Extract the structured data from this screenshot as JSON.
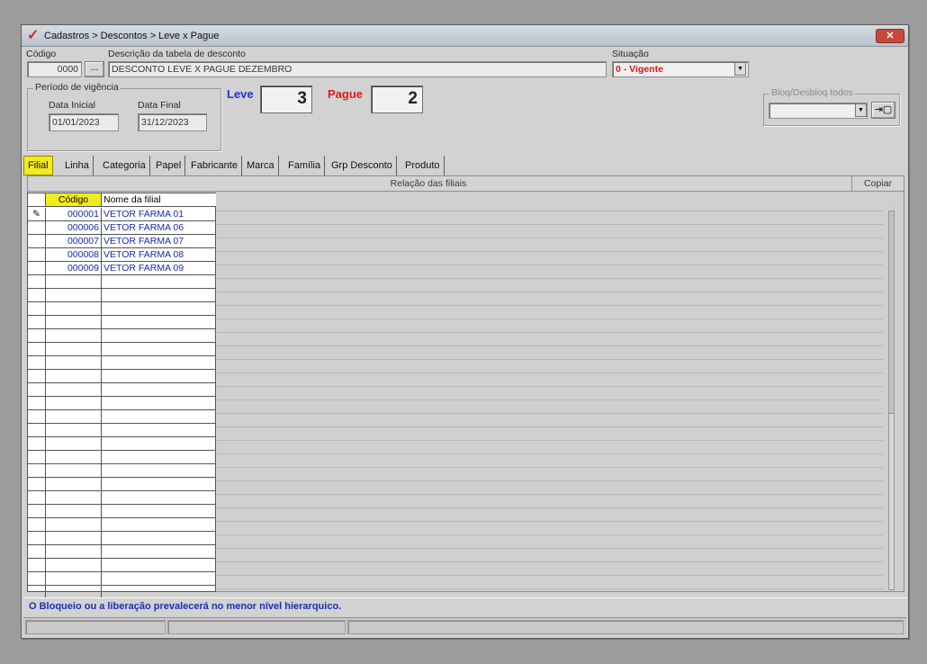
{
  "window": {
    "title": "Cadastros > Descontos > Leve x Pague"
  },
  "header": {
    "codigo_label": "Código",
    "codigo_value": "0000",
    "codigo_lookup": "...",
    "descricao_label": "Descrição da tabela de desconto",
    "descricao_value": "DESCONTO LEVE X PAGUE DEZEMBRO",
    "situacao_label": "Situação",
    "situacao_value": "0 - Vigente"
  },
  "periodo": {
    "title": "Período de vigência",
    "data_inicial_label": "Data Inicial",
    "data_inicial_value": "01/01/2023",
    "data_final_label": "Data Final",
    "data_final_value": "31/12/2023"
  },
  "leve_pague": {
    "leve_label": "Leve",
    "leve_value": "3",
    "pague_label": "Pague",
    "pague_value": "2"
  },
  "bloq": {
    "title": "Bloq/Desbloq todos",
    "value": "",
    "apply_icon": "arrow-into-box-icon"
  },
  "tabs": [
    "Filial",
    "Linha",
    "Categoria",
    "Papel",
    "Fabricante",
    "Marca",
    "Família",
    "Grp Desconto",
    "Produto"
  ],
  "grid": {
    "title": "Relação das filiais",
    "copy_label": "Copiar",
    "columns": [
      "Código",
      "Nome da filial"
    ],
    "rows": [
      {
        "codigo": "000001",
        "nome": "VETOR FARMA 01"
      },
      {
        "codigo": "000006",
        "nome": "VETOR FARMA 06"
      },
      {
        "codigo": "000007",
        "nome": "VETOR FARMA 07"
      },
      {
        "codigo": "000008",
        "nome": "VETOR FARMA 08"
      },
      {
        "codigo": "000009",
        "nome": "VETOR FARMA 09"
      }
    ],
    "edit_icon": "pencil-icon"
  },
  "status": {
    "message": "O Bloqueio ou a liberação prevalecerá no menor nível hierarquico."
  },
  "colors": {
    "leve": "#2233cc",
    "pague": "#dd1a1a",
    "situacao": "#d41a1a",
    "active_tab": "#f2eb1f",
    "status_text": "#1c2fb0",
    "row_text": "#1a2aa8"
  }
}
